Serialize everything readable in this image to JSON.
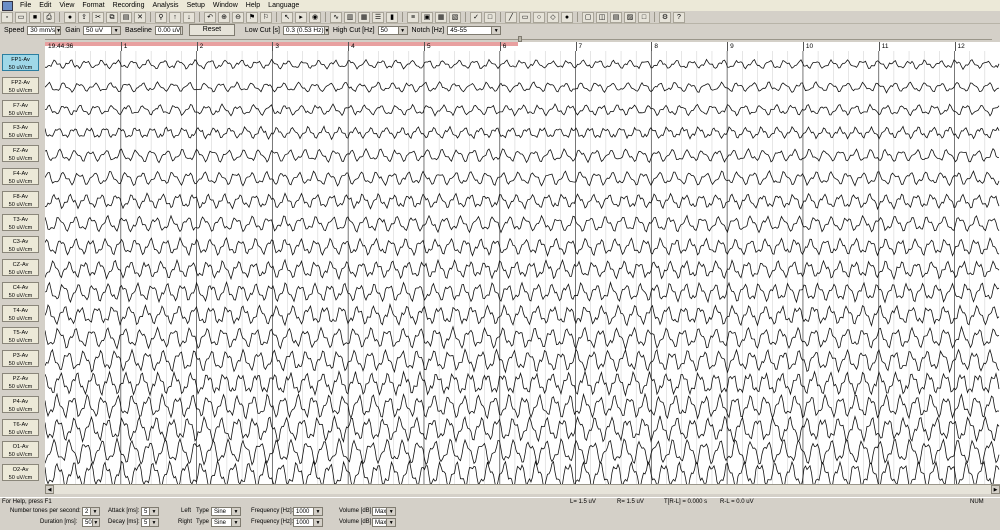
{
  "menu": [
    "File",
    "Edit",
    "View",
    "Format",
    "Recording",
    "Analysis",
    "Setup",
    "Window",
    "Help",
    "Language"
  ],
  "toolbar2": {
    "speed_label": "Speed",
    "speed_value": "30 mm/s",
    "gain_label": "Gain",
    "gain_value": "50 uV",
    "baseline_label": "Baseline",
    "baseline_value": "0.00 uV",
    "reset_label": "Reset",
    "lowcut_label": "Low Cut [s]",
    "lowcut_value": "0.3   (0.53 Hz)",
    "highcut_label": "High Cut [Hz]",
    "highcut_value": "50",
    "notch_label": "Notch [Hz]",
    "notch_value": "45-55"
  },
  "timeline": {
    "start_time": "19.44.36",
    "seconds": [
      "1",
      "2",
      "3",
      "4",
      "5",
      "6",
      "7",
      "8",
      "9",
      "10",
      "11",
      "12"
    ]
  },
  "channels": [
    {
      "name": "FP1-Av",
      "unit": "50 uV/cm",
      "selected": true
    },
    {
      "name": "FP2-Av",
      "unit": "50 uV/cm"
    },
    {
      "name": "F7-Av",
      "unit": "50 uV/cm"
    },
    {
      "name": "F3-Av",
      "unit": "50 uV/cm"
    },
    {
      "name": "FZ-Av",
      "unit": "50 uV/cm"
    },
    {
      "name": "F4-Av",
      "unit": "50 uV/cm"
    },
    {
      "name": "F8-Av",
      "unit": "50 uV/cm"
    },
    {
      "name": "T3-Av",
      "unit": "50 uV/cm"
    },
    {
      "name": "C3-Av",
      "unit": "50 uV/cm"
    },
    {
      "name": "CZ-Av",
      "unit": "50 uV/cm"
    },
    {
      "name": "C4-Av",
      "unit": "50 uV/cm"
    },
    {
      "name": "T4-Av",
      "unit": "50 uV/cm"
    },
    {
      "name": "T5-Av",
      "unit": "50 uV/cm"
    },
    {
      "name": "P3-Av",
      "unit": "50 uV/cm"
    },
    {
      "name": "PZ-Av",
      "unit": "50 uV/cm"
    },
    {
      "name": "P4-Av",
      "unit": "50 uV/cm"
    },
    {
      "name": "T6-Av",
      "unit": "50 uV/cm"
    },
    {
      "name": "O1-Av",
      "unit": "50 uV/cm"
    },
    {
      "name": "O2-Av",
      "unit": "50 uV/cm"
    }
  ],
  "status": {
    "help": "For Help, press F1",
    "L": "L=   1.5 uV",
    "R": "R=   1.5 uV",
    "T": "T[R-L] = 0.000 s",
    "RL": "R-L =   0.0 uV",
    "num": "NUM"
  },
  "bottom": {
    "tones_label": "Number tones per second:",
    "tones_value": "2",
    "duration_label": "Duration [ms]:",
    "duration_value": "50",
    "attack_label": "Attack [ms]:",
    "attack_value": "5",
    "decay_label": "Decay [ms]:",
    "decay_value": "5",
    "left_label": "Left",
    "right_label": "Right",
    "type_label": "Type",
    "type_left": "Sine",
    "type_right": "Sine",
    "freq_label": "Frequency [Hz]:",
    "freq_left": "1000",
    "freq_right": "1000",
    "vol_label": "Volume [dB]:",
    "vol_left": "Max",
    "vol_right": "Max"
  }
}
